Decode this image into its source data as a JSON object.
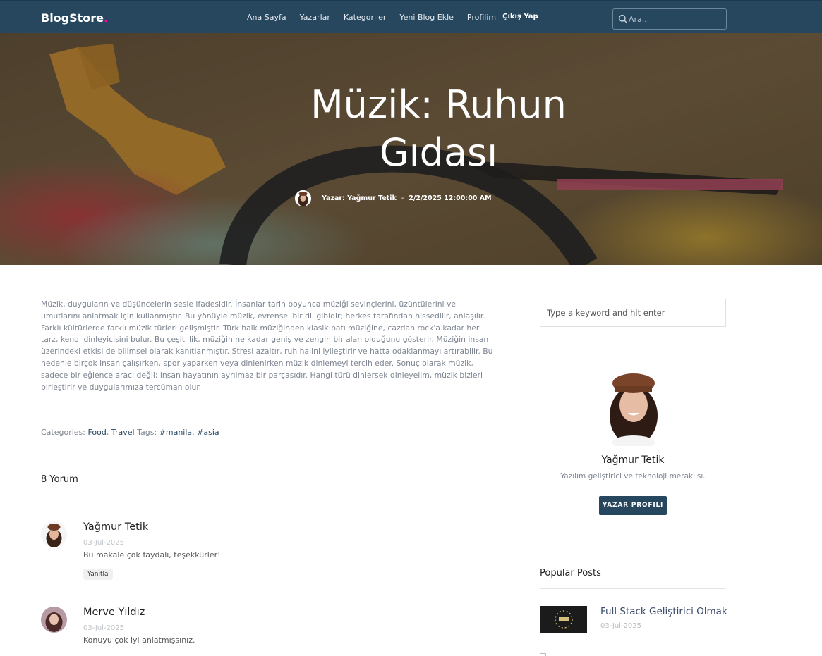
{
  "navbar": {
    "brand": "BlogStore",
    "brand_dot": ".",
    "links": [
      "Ana Sayfa",
      "Yazarlar",
      "Kategoriler",
      "Yeni Blog Ekle",
      "Profilim"
    ],
    "logout": "Çıkış Yap",
    "search_placeholder": "Ara..."
  },
  "hero": {
    "title_line1": "Müzik: Ruhun",
    "title_line2": "Gıdası",
    "author": "Yazar: Yağmur Tetik",
    "separator": "-",
    "date": "2/2/2025 12:00:00 AM"
  },
  "article": {
    "body": "Müzik, duyguların ve düşüncelerin sesle ifadesidir. İnsanlar tarih boyunca müziği sevinçlerini, üzüntülerini ve umutlarını anlatmak için kullanmıştır. Bu yönüyle müzik, evrensel bir dil gibidir; herkes tarafından hissedilir, anlaşılır. Farklı kültürlerde farklı müzik türleri gelişmiştir. Türk halk müziğinden klasik batı müziğine, cazdan rock'a kadar her tarz, kendi dinleyicisini bulur. Bu çeşitlilik, müziğin ne kadar geniş ve zengin bir alan olduğunu gösterir. Müziğin insan üzerindeki etkisi de bilimsel olarak kanıtlanmıştır. Stresi azaltır, ruh halini iyileştirir ve hatta odaklanmayı artırabilir. Bu nedenle birçok insan çalışırken, spor yaparken veya dinlenirken müzik dinlemeyi tercih eder. Sonuç olarak müzik, sadece bir eğlence aracı değil; insan hayatının ayrılmaz bir parçasıdır. Hangi türü dinlersek dinleyelim, müzik bizleri birleştirir ve duygularımıza tercüman olur.",
    "categories_label": "Categories:",
    "category1": "Food",
    "comma": ",",
    "category2": "Travel",
    "tags_label": "Tags:",
    "tag1": "#manila",
    "tag2": "#asia"
  },
  "comments": {
    "count_label": "8 Yorum",
    "reply_label": "Yanıtla",
    "items": [
      {
        "name": "Yağmur Tetik",
        "date": "03-Jul-2025",
        "text": "Bu makale çok faydalı, teşekkürler!"
      },
      {
        "name": "Merve Yıldız",
        "date": "03-Jul-2025",
        "text": "Konuyu çok iyi anlatmışsınız."
      }
    ]
  },
  "sidebar": {
    "search_placeholder": "Type a keyword and hit enter",
    "author": {
      "name": "Yağmur Tetik",
      "bio": "Yazılım geliştirici ve teknoloji meraklısı.",
      "button": "YAZAR PROFILI"
    },
    "popular": {
      "title": "Popular Posts",
      "items": [
        {
          "title": "Full Stack Geliştirici Olmak",
          "date": "03-Jul-2025"
        }
      ]
    }
  },
  "colors": {
    "navbar": "#27475f",
    "accent": "#27475f",
    "muted_text": "#7d8590"
  }
}
